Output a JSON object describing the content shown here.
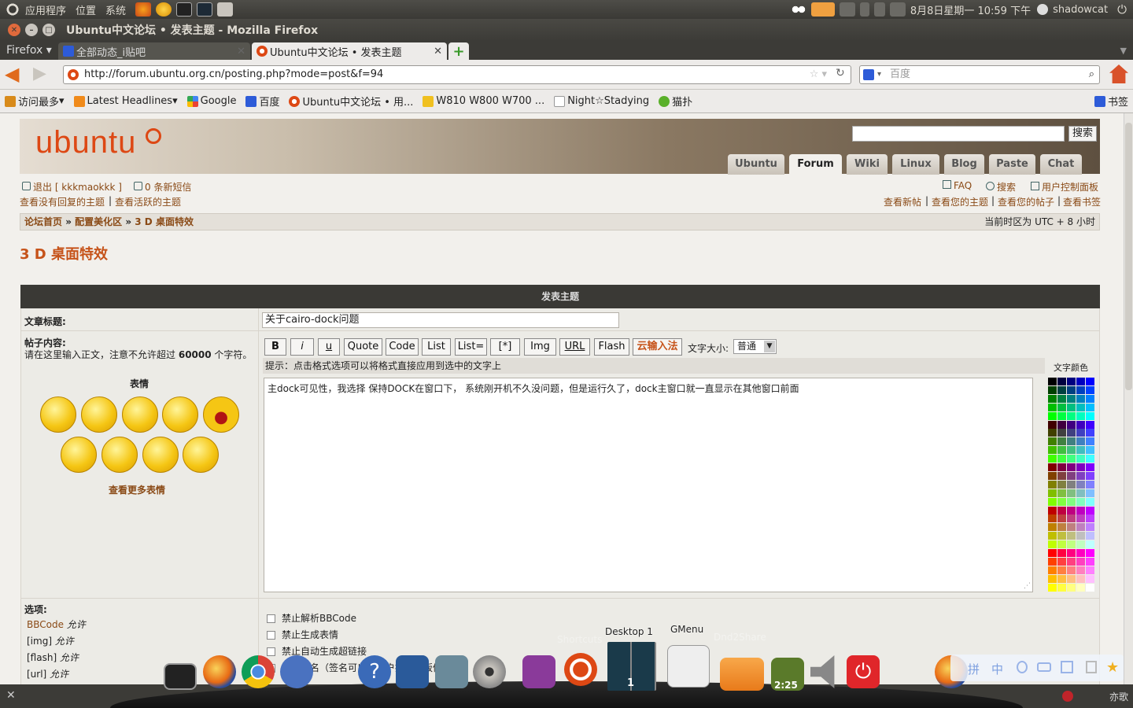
{
  "top_panel": {
    "menus": [
      "应用程序",
      "位置",
      "系统"
    ],
    "datetime": "8月8日星期一 10:59 下午",
    "user": "shadowcat"
  },
  "window": {
    "title": "Ubuntu中文论坛 • 发表主题 - Mozilla Firefox"
  },
  "tabs": {
    "firefox_menu": "Firefox",
    "items": [
      {
        "label": "全部动态_i贴吧"
      },
      {
        "label": "Ubuntu中文论坛 • 发表主题"
      }
    ]
  },
  "nav": {
    "url": "http://forum.ubuntu.org.cn/posting.php?mode=post&f=94",
    "search_placeholder": "百度"
  },
  "bookmarks": [
    "访问最多",
    "Latest Headlines",
    "Google",
    "百度",
    "Ubuntu中文论坛 • 用...",
    "W810 W800 W700 ...",
    "Night☆Stadying",
    "猫扑"
  ],
  "bookmarks_menu": "书签",
  "site": {
    "logo": "ubuntu",
    "search_button": "搜索",
    "nav_tabs": [
      "Ubuntu",
      "Forum",
      "Wiki",
      "Linux",
      "Blog",
      "Paste",
      "Chat"
    ],
    "active_tab": "Forum",
    "logout": "退出 [ kkkmaokkk ]",
    "messages": "0 条新短信",
    "links_left": [
      "查看没有回复的主题",
      "查看活跃的主题"
    ],
    "faq": "FAQ",
    "search": "搜索",
    "ucp": "用户控制面板",
    "links_right": [
      "查看新帖",
      "查看您的主题",
      "查看您的帖子",
      "查看书签"
    ],
    "breadcrumb": [
      "论坛首页",
      "配置美化区",
      "3 D 桌面特效"
    ],
    "timezone": "当前时区为 UTC + 8 小时",
    "page_title": "3 D 桌面特效"
  },
  "form": {
    "header": "发表主题",
    "subject_label": "文章标题:",
    "subject_value": "关于cairo-dock问题",
    "body_label": "帖子内容:",
    "body_hint_prefix": "请在这里输入正文，注意不允许超过",
    "body_hint_limit": "60000",
    "body_hint_suffix": "个字符。",
    "smilies_title": "表情",
    "more_smilies": "查看更多表情",
    "buttons": [
      "B",
      "i",
      "u",
      "Quote",
      "Code",
      "List",
      "List=",
      "[*]",
      "Img",
      "URL",
      "Flash",
      "云输入法"
    ],
    "font_size_label": "文字大小:",
    "font_size_value": "普通",
    "tip": "提示：点击格式选项可以将格式直接应用到选中的文字上",
    "color_label": "文字颜色",
    "body_text": "主dock可见性，我选择 保持DOCK在窗口下， 系统刚开机不久没问题，但是运行久了，dock主窗口就一直显示在其他窗口前面",
    "options_label": "选项:",
    "options_left": [
      {
        "name": "BBCode",
        "state": "允许"
      },
      {
        "name": "[img]",
        "state": "允许"
      },
      {
        "name": "[flash]",
        "state": "允许"
      },
      {
        "name": "[url]",
        "state": "允许"
      }
    ],
    "checkboxes": [
      "禁止解析BBCode",
      "禁止生成表情",
      "禁止自动生成超链接",
      "添加签名（签名可以在用户控制面板修改）"
    ]
  },
  "dock": {
    "labels": [
      "Shortcuts",
      "Desktop 1",
      "GMenu",
      "Dnd2Share"
    ],
    "clock": "2:25",
    "desktop_number": "1"
  },
  "ime_bar": [
    "拼",
    "中"
  ],
  "status_right": "亦歌"
}
